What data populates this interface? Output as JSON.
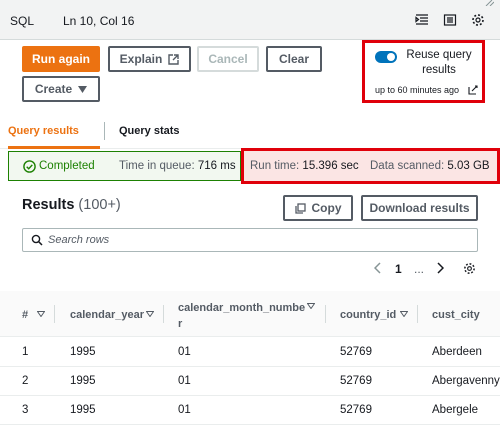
{
  "statusbar": {
    "language": "SQL",
    "cursor_position": "Ln 10, Col 16"
  },
  "toolbar": {
    "run_again": "Run again",
    "explain": "Explain",
    "cancel": "Cancel",
    "clear": "Clear",
    "create": "Create"
  },
  "reuse": {
    "label": "Reuse query results",
    "enabled": true,
    "max_age": "up to 60 minutes ago"
  },
  "tabs": [
    "Query results",
    "Query stats"
  ],
  "status": {
    "state": "Completed",
    "queue_label": "Time in queue:",
    "queue_value": "716 ms",
    "runtime_label": "Run time:",
    "runtime_value": "15.396 sec",
    "scanned_label": "Data scanned:",
    "scanned_value": "5.03 GB"
  },
  "results": {
    "title": "Results",
    "count": "(100+)",
    "copy": "Copy",
    "download": "Download results",
    "search_placeholder": "Search rows"
  },
  "pager": {
    "current_page": "1",
    "ellipsis": "..."
  },
  "table": {
    "columns": [
      "#",
      "calendar_year",
      "calendar_month_numbe r",
      "country_id",
      "cust_city"
    ],
    "rows": [
      [
        "1",
        "1995",
        "01",
        "52769",
        "Aberdeen"
      ],
      [
        "2",
        "1995",
        "01",
        "52769",
        "Abergavenny"
      ],
      [
        "3",
        "1995",
        "01",
        "52769",
        "Abergele"
      ]
    ]
  },
  "colors": {
    "accent": "#ec7211",
    "success": "#1d8102",
    "toggle_on": "#0073bb",
    "highlight": "#e0000a"
  }
}
